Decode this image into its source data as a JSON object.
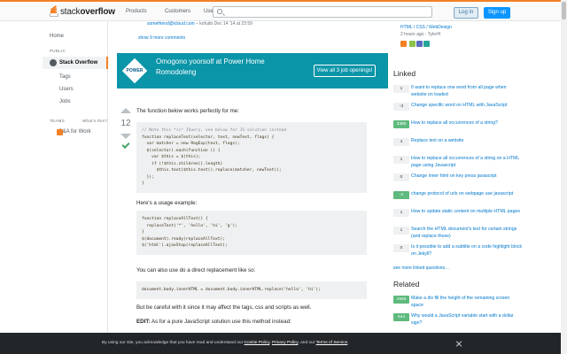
{
  "header": {
    "logo_text_light": "stack",
    "logo_text_bold": "overflow",
    "nav": [
      "Products",
      "Customers",
      "Use cases"
    ],
    "search_placeholder": "Search…",
    "login_label": "Log in",
    "signup_label": "Sign up"
  },
  "leftnav": {
    "home": "Home",
    "public": "PUBLIC",
    "stack_overflow": "Stack Overflow",
    "tags": "Tags",
    "users": "Users",
    "jobs": "Jobs",
    "teams": "TEAMS",
    "whats_this": "What's this?",
    "qa_for_work": "Q&A for Work"
  },
  "main": {
    "comment_link": "somefriend@icloud.com",
    "comment_meta": "– kofudo Dec 14 '14 at 23:59",
    "show_more": "show 9 more comments",
    "ad": {
      "logo": "POWER",
      "title": "Omogono yoorsolf at Power Home Romodoleng",
      "button": "View all 3 job openings!"
    },
    "vote_count": "12",
    "intro": "The function below works perfectly for me:",
    "code1": [
      "// Note this *is* JQuery, see below for JS solution instead",
      "function replaceText(selector, text, newText, flags) {",
      "  var matcher = new RegExp(text, flags);",
      "  $(selector).each(function () {",
      "    var $this = $(this);",
      "    if (!$this.children().length)",
      "      $this.text($this.text().replace(matcher, newText));",
      "  });",
      "}"
    ],
    "usage_title": "Here's a usage example:",
    "code2": [
      "function replaceAllText() {",
      "  replaceText('*', 'hello', 'hi', 'g');",
      "}",
      "",
      "$(document).ready(replaceAllText);",
      "$('html').ajaxStop(replaceAllText);"
    ],
    "direct_text": "You can also use do a direct replacement like so:",
    "code3": "document.body.innerHTML = document.body.innerHTML.replace('hello', 'hi');",
    "careful_text": "But be careful with it since it may affect the tags, css and scripts as well.",
    "edit_label": "EDIT:",
    "edit_text": "As for a pure JavaScript solution use this method instead:"
  },
  "right": {
    "top_link": "HTML / CSS / WebDesign",
    "top_meta": "2 hours ago - TylerH",
    "linked_title": "Linked",
    "linked": [
      {
        "score": "1",
        "text": "0 want to replace one word from all page when website on loaded",
        "green": false
      },
      {
        "score": "-3",
        "text": "Change specific word on HTML with JavaScript",
        "green": false
      },
      {
        "score": "3380",
        "text": "How to replace all occurrences of a string?",
        "green": true
      },
      {
        "score": "4",
        "text": "Replace text on a website",
        "green": false
      },
      {
        "score": "1",
        "text": "How to replace all occurrences of a string on a HTML page using Javascript",
        "green": false
      },
      {
        "score": "0",
        "text": "Change inner html on key press javascript",
        "green": false
      },
      {
        "score": "-4",
        "text": "change protocol of urls on webpage use javascript",
        "green": true
      },
      {
        "score": "1",
        "text": "How to update static content on multiple HTML pages",
        "green": false
      },
      {
        "score": "1",
        "text": "Search the HTML document's text for certain strings (and replace those)",
        "green": false
      },
      {
        "score": "0",
        "text": "Is it possible to add a subtitle on a code highlight block on Jekyll?",
        "green": false
      }
    ],
    "more_linked": "see more linked questions…",
    "related_title": "Related",
    "related": [
      {
        "score": "1945",
        "text": "Make a div fill the height of the remaining screen space",
        "green": true
      },
      {
        "score": "644",
        "text": "Why would a JavaScript variable start with a dollar sign?",
        "green": true
      }
    ]
  },
  "cookie": {
    "prefix": "By using our site, you acknowledge that you have read and understand our",
    "cookie_policy": "Cookie Policy",
    "privacy_policy": "Privacy Policy",
    "and_our": ", and our",
    "terms": "Terms of Service"
  },
  "colors": {
    "accent": "#f48024",
    "link": "#0077cc",
    "ad_bg": "#0a95a8",
    "answered_green": "#5eba7d"
  }
}
